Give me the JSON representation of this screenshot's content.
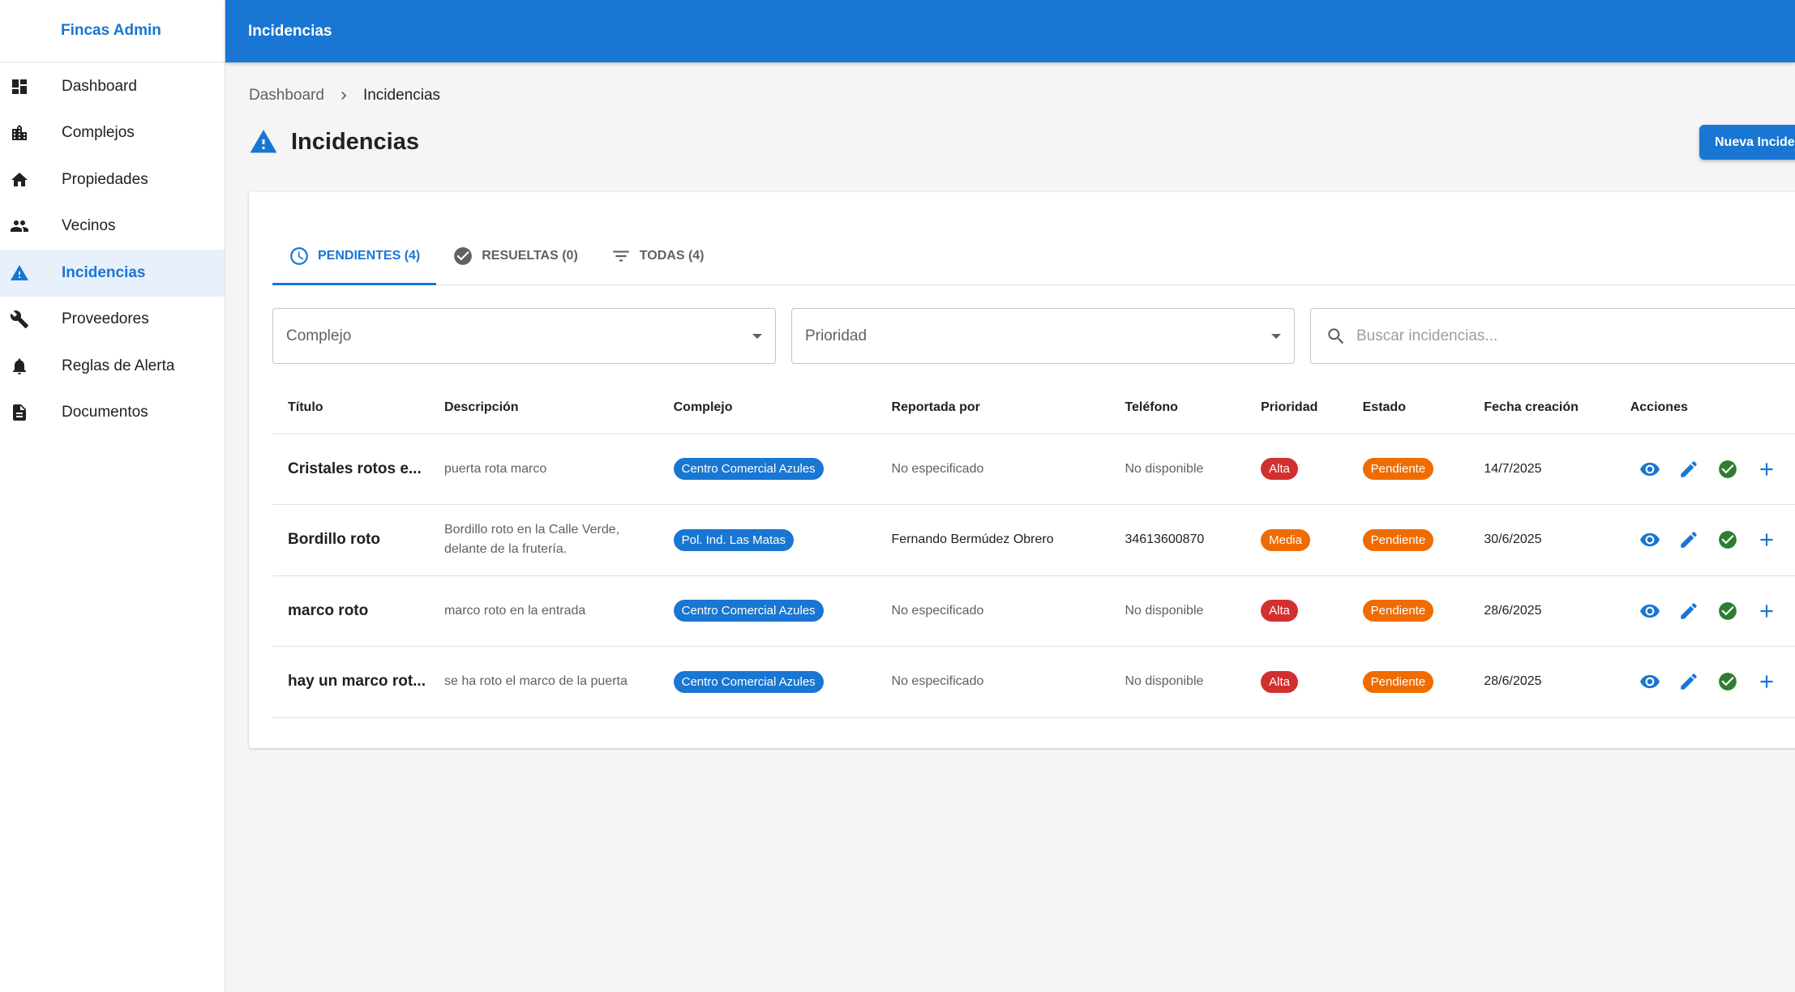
{
  "app": {
    "brand": "Fincas Admin",
    "topbar_title": "Incidencias"
  },
  "sidebar": {
    "items": [
      {
        "label": "Dashboard",
        "icon": "dashboard-icon",
        "active": false
      },
      {
        "label": "Complejos",
        "icon": "building-icon",
        "active": false
      },
      {
        "label": "Propiedades",
        "icon": "home-icon",
        "active": false
      },
      {
        "label": "Vecinos",
        "icon": "people-icon",
        "active": false
      },
      {
        "label": "Incidencias",
        "icon": "warning-icon",
        "active": true
      },
      {
        "label": "Proveedores",
        "icon": "wrench-icon",
        "active": false
      },
      {
        "label": "Reglas de Alerta",
        "icon": "bell-icon",
        "active": false
      },
      {
        "label": "Documentos",
        "icon": "document-icon",
        "active": false
      }
    ]
  },
  "breadcrumb": {
    "home": "Dashboard",
    "current": "Incidencias"
  },
  "page": {
    "title": "Incidencias",
    "new_button": "Nueva Incidencia"
  },
  "tabs": [
    {
      "label": "PENDIENTES (4)",
      "icon": "clock-icon",
      "active": true
    },
    {
      "label": "RESUELTAS (0)",
      "icon": "check-circle-icon",
      "active": false
    },
    {
      "label": "TODAS (4)",
      "icon": "filter-icon",
      "active": false
    }
  ],
  "filters": {
    "complejo_label": "Complejo",
    "prioridad_label": "Prioridad",
    "search_placeholder": "Buscar incidencias..."
  },
  "table": {
    "headers": {
      "titulo": "Título",
      "descripcion": "Descripción",
      "complejo": "Complejo",
      "reportada": "Reportada por",
      "telefono": "Teléfono",
      "prioridad": "Prioridad",
      "estado": "Estado",
      "fecha": "Fecha creación",
      "acciones": "Acciones"
    },
    "rows": [
      {
        "titulo": "Cristales rotos e...",
        "descripcion": "puerta rota marco",
        "complejo": "Centro Comercial Azules",
        "reportada": "No especificado",
        "telefono": "No disponible",
        "prioridad": "Alta",
        "estado": "Pendiente",
        "fecha": "14/7/2025"
      },
      {
        "titulo": "Bordillo roto",
        "descripcion": "Bordillo roto en la Calle Verde, delante de la frutería.",
        "complejo": "Pol. Ind. Las Matas",
        "reportada": "Fernando Bermúdez Obrero",
        "telefono": "34613600870",
        "prioridad": "Media",
        "estado": "Pendiente",
        "fecha": "30/6/2025"
      },
      {
        "titulo": "marco roto",
        "descripcion": "marco roto en la entrada",
        "complejo": "Centro Comercial Azules",
        "reportada": "No especificado",
        "telefono": "No disponible",
        "prioridad": "Alta",
        "estado": "Pendiente",
        "fecha": "28/6/2025"
      },
      {
        "titulo": "hay un marco rot...",
        "descripcion": "se ha roto el marco de la puerta",
        "complejo": "Centro Comercial Azules",
        "reportada": "No especificado",
        "telefono": "No disponible",
        "prioridad": "Alta",
        "estado": "Pendiente",
        "fecha": "28/6/2025"
      }
    ]
  },
  "colors": {
    "primary": "#1976d2",
    "alta": "#d32f2f",
    "media": "#ef6c00",
    "pendiente": "#ef6c00",
    "success": "#2e7d32"
  }
}
